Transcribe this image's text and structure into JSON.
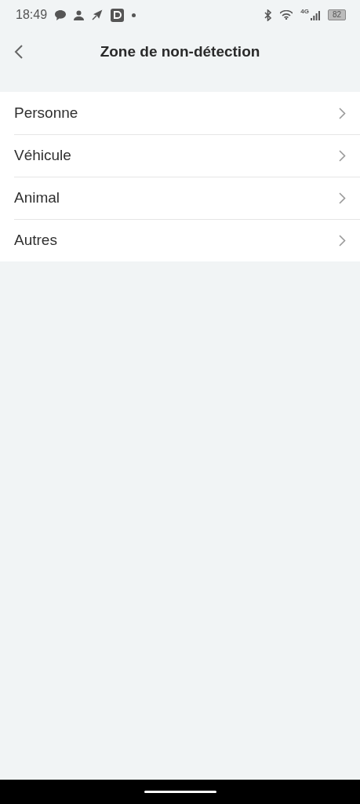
{
  "status_bar": {
    "time": "18:49",
    "network": "4G",
    "battery": "82"
  },
  "header": {
    "title": "Zone de non-détection"
  },
  "items": [
    {
      "label": "Personne"
    },
    {
      "label": "Véhicule"
    },
    {
      "label": "Animal"
    },
    {
      "label": "Autres"
    }
  ]
}
